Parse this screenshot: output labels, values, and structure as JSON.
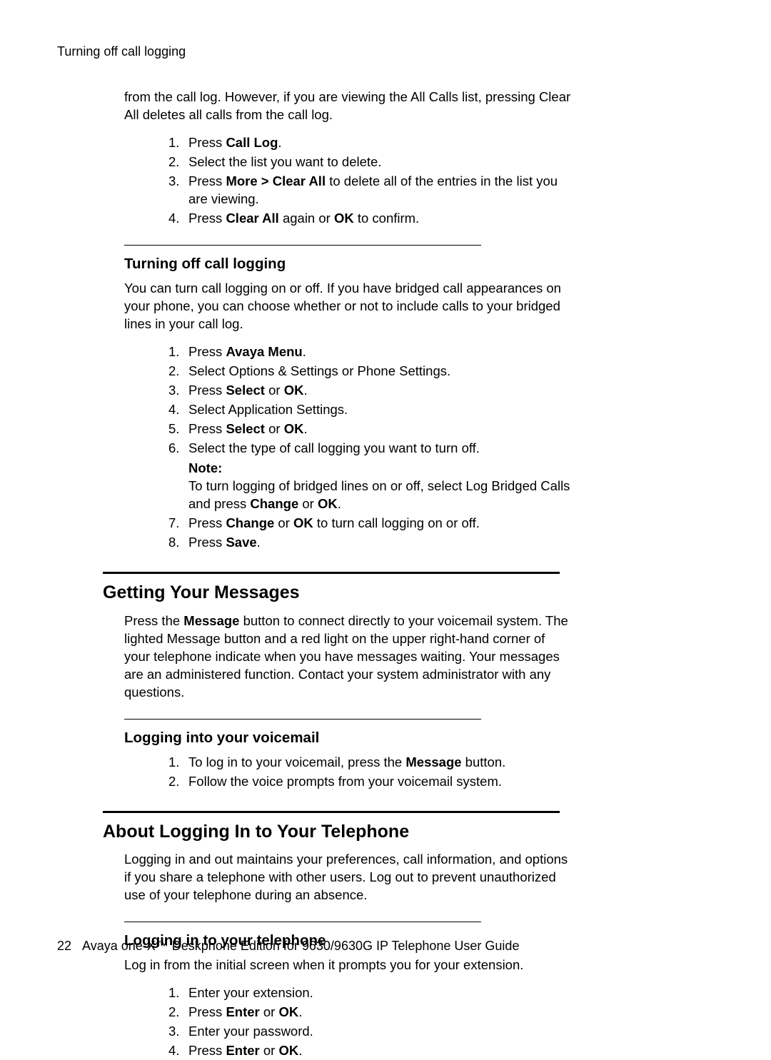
{
  "running_head": "Turning off call logging",
  "intro_top": {
    "text_parts": [
      "from the call log. However, if you are viewing the All Calls list, pressing Clear All deletes all calls from the call log."
    ]
  },
  "steps_top": [
    {
      "n": "1.",
      "parts": [
        "Press ",
        {
          "b": "Call Log"
        },
        "."
      ]
    },
    {
      "n": "2.",
      "parts": [
        "Select the list you want to delete."
      ]
    },
    {
      "n": "3.",
      "parts": [
        "Press  ",
        {
          "b": "More > Clear All"
        },
        "  to delete all of the entries in the list you are viewing."
      ]
    },
    {
      "n": "4.",
      "parts": [
        "Press ",
        {
          "b": "Clear All"
        },
        " again or ",
        {
          "b": "OK"
        },
        " to confirm."
      ]
    }
  ],
  "sec1": {
    "title": "Turning off call logging",
    "intro": "You can turn call logging on or off. If you have bridged call appearances on your phone, you can choose whether or not to include calls to your bridged lines in your call log.",
    "steps": [
      {
        "n": "1.",
        "parts": [
          "Press ",
          {
            "b": "Avaya Menu"
          },
          "."
        ]
      },
      {
        "n": "2.",
        "parts": [
          "Select Options & Settings or Phone Settings."
        ]
      },
      {
        "n": "3.",
        "parts": [
          "Press ",
          {
            "b": "Select"
          },
          " or ",
          {
            "b": "OK"
          },
          "."
        ]
      },
      {
        "n": "4.",
        "parts": [
          "Select Application Settings."
        ]
      },
      {
        "n": "5.",
        "parts": [
          "Press ",
          {
            "b": "Select"
          },
          " or ",
          {
            "b": "OK"
          },
          "."
        ]
      },
      {
        "n": "6.",
        "parts": [
          "Select the type of call logging you want to turn off."
        ],
        "note": {
          "label": "Note:",
          "body_parts": [
            "To turn logging of bridged lines on or off, select Log Bridged Calls and press ",
            {
              "b": "Change"
            },
            " or ",
            {
              "b": "OK"
            },
            "."
          ]
        }
      },
      {
        "n": "7.",
        "parts": [
          "Press ",
          {
            "b": "Change"
          },
          " or ",
          {
            "b": "OK"
          },
          " to turn call logging on or off."
        ]
      },
      {
        "n": "8.",
        "parts": [
          "Press ",
          {
            "b": "Save"
          },
          "."
        ]
      }
    ]
  },
  "sec2": {
    "title": "Getting Your Messages",
    "intro_parts": [
      "Press the ",
      {
        "b": "Message"
      },
      " button to connect directly to your voicemail system. The lighted Message button and a red light on the upper right-hand corner of your telephone indicate when you have messages waiting. Your messages are an administered function. Contact your system administrator with any questions."
    ],
    "sub": {
      "title": "Logging into your voicemail",
      "steps": [
        {
          "n": "1.",
          "parts": [
            "To log in to your voicemail, press the ",
            {
              "b": "Message"
            },
            " button."
          ]
        },
        {
          "n": "2.",
          "parts": [
            "Follow the voice prompts from your voicemail system."
          ]
        }
      ]
    }
  },
  "sec3": {
    "title": "About Logging In to Your Telephone",
    "intro": "Logging in and out maintains your preferences, call information, and options if you share a telephone with other users. Log out to prevent unauthorized use of your telephone during an absence.",
    "sub": {
      "title": "Logging in to your telephone",
      "intro": "Log in from the initial screen when it prompts you for your extension.",
      "steps": [
        {
          "n": "1.",
          "parts": [
            "Enter your extension."
          ]
        },
        {
          "n": "2.",
          "parts": [
            "Press ",
            {
              "b": "Enter"
            },
            " or ",
            {
              "b": "OK"
            },
            "."
          ]
        },
        {
          "n": "3.",
          "parts": [
            "Enter your password."
          ]
        },
        {
          "n": "4.",
          "parts": [
            "Press ",
            {
              "b": "Enter"
            },
            " or ",
            {
              "b": "OK"
            },
            "."
          ]
        }
      ]
    }
  },
  "footer": {
    "page_no": "22",
    "text": "Avaya one-X™ Deskphone Edition for 9630/9630G IP Telephone User Guide"
  }
}
